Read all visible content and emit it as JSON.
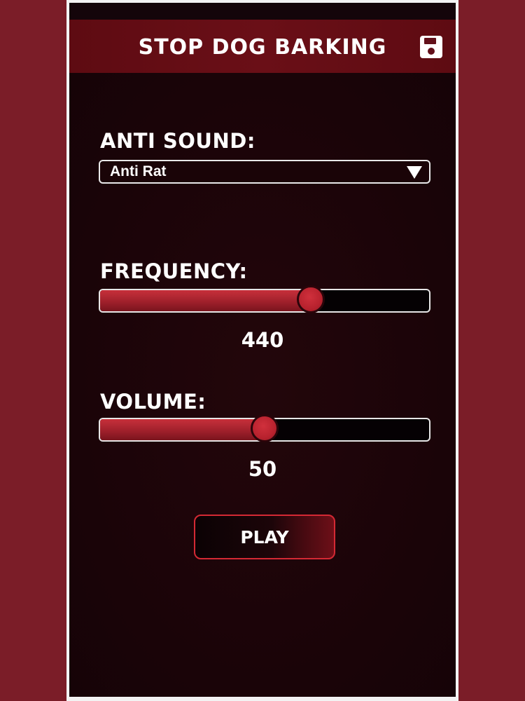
{
  "header": {
    "title": "STOP DOG BARKING",
    "save_icon": "floppy-disk-icon"
  },
  "anti_sound": {
    "label": "ANTI SOUND:",
    "selected": "Anti Rat",
    "arrow_icon": "triangle-down-icon"
  },
  "frequency": {
    "label": "FREQUENCY:",
    "value": "440",
    "fill_fraction": 0.64
  },
  "volume": {
    "label": "VOLUME:",
    "value": "50",
    "fill_fraction": 0.5
  },
  "play_button": {
    "label": "PLAY"
  },
  "colors": {
    "background": "#7b1d28",
    "header": "#6a0f17",
    "accent": "#c7303b",
    "panel": "#1b0508"
  }
}
